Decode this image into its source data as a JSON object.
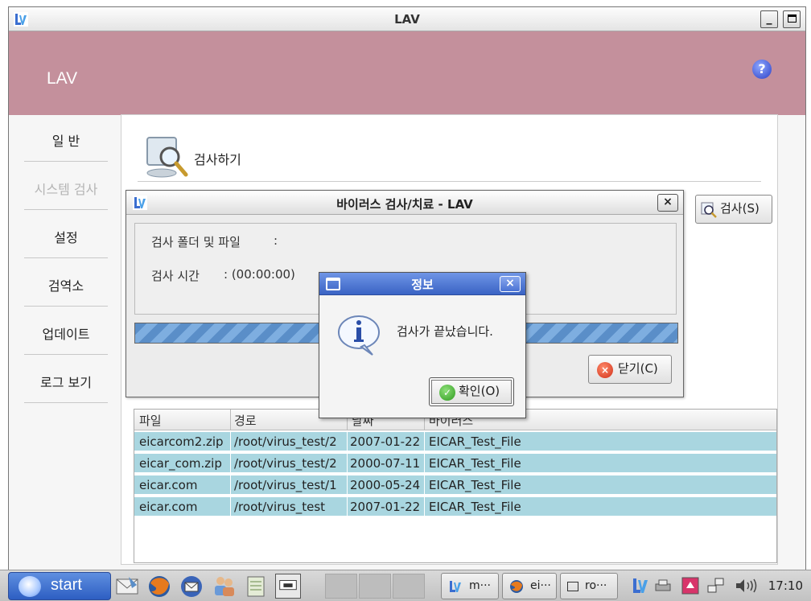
{
  "window": {
    "title": "LAV",
    "minimize": "_",
    "maximize": ""
  },
  "banner": {
    "app_name": "LAV",
    "help": "?"
  },
  "nav": {
    "items": [
      {
        "label": "일 반",
        "enabled": true
      },
      {
        "label": "시스템 검사",
        "enabled": false
      },
      {
        "label": "설정",
        "enabled": true
      },
      {
        "label": "검역소",
        "enabled": true
      },
      {
        "label": "업데이트",
        "enabled": true
      },
      {
        "label": "로그 보기",
        "enabled": true
      }
    ]
  },
  "content": {
    "title": "검사하기",
    "scan_button": "검사(S)"
  },
  "table": {
    "columns": [
      "파일",
      "경로",
      "날짜",
      "바이러스"
    ],
    "rows": [
      [
        "eicarcom2.zip",
        "/root/virus_test/2",
        "2007-01-22",
        "EICAR_Test_File"
      ],
      [
        "eicar_com.zip",
        "/root/virus_test/2",
        "2000-07-11",
        "EICAR_Test_File"
      ],
      [
        "eicar.com",
        "/root/virus_test/1",
        "2000-05-24",
        "EICAR_Test_File"
      ],
      [
        "eicar.com",
        "/root/virus_test",
        "2007-01-22",
        "EICAR_Test_File"
      ]
    ]
  },
  "scan_dialog": {
    "title": "바이러스 검사/치료 - LAV",
    "close": "×",
    "folder_label": "검사 폴더 및 파일",
    "folder_sep": ":",
    "time_label": "검사 시간",
    "time_value": ": (00:00:00)",
    "close_button": "닫기(C)"
  },
  "info_dialog": {
    "title": "정보",
    "close": "×",
    "message": "검사가 끝났습니다.",
    "ok_button": "확인(O)"
  },
  "taskbar": {
    "start": "start",
    "tasks": [
      "m···",
      "ei···",
      "ro···"
    ],
    "clock": "17:10"
  },
  "colors": {
    "banner": "#c4909c",
    "row_highlight": "#a9d6e0",
    "info_titlebar": "#3a63c4",
    "progress": "#5a8ec8"
  }
}
